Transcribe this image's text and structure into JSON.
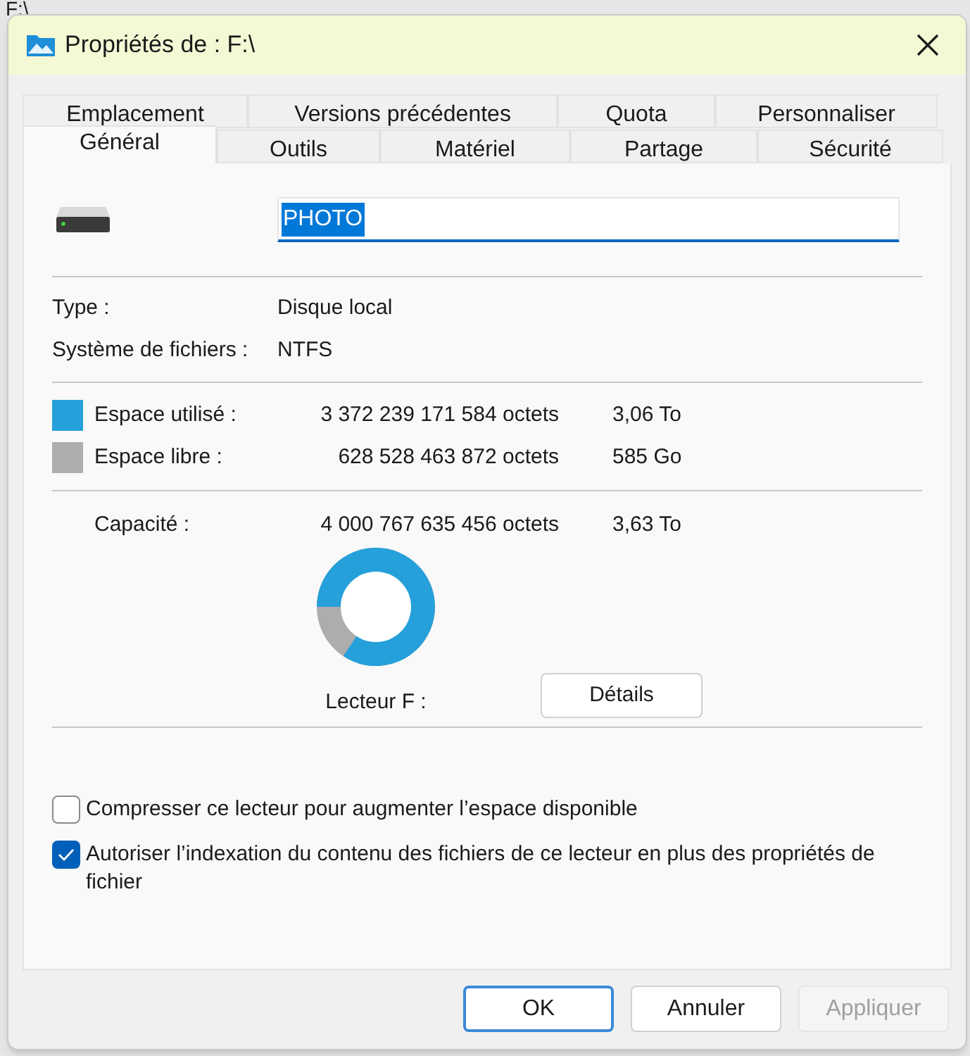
{
  "background": {
    "path": "F:\\"
  },
  "window": {
    "title": "Propriétés de : F:\\"
  },
  "tabs": {
    "row_1": [
      {
        "label": "Emplacement",
        "selected": false
      },
      {
        "label": "Versions précédentes",
        "selected": false
      },
      {
        "label": "Quota",
        "selected": false
      },
      {
        "label": "Personnaliser",
        "selected": false
      }
    ],
    "row_2": [
      {
        "label": "Général",
        "selected": true
      },
      {
        "label": "Outils",
        "selected": false
      },
      {
        "label": "Matériel",
        "selected": false
      },
      {
        "label": "Partage",
        "selected": false
      },
      {
        "label": "Sécurité",
        "selected": false
      }
    ]
  },
  "name_field": {
    "value": "PHOTO"
  },
  "info": [
    {
      "label": "Type :",
      "value": "Disque local"
    },
    {
      "label": "Système de fichiers :",
      "value": "NTFS"
    }
  ],
  "space": [
    {
      "label": "Espace utilisé :",
      "bytes": "3 372 239 171 584 octets",
      "size": "3,06 To",
      "color": "#26a0da"
    },
    {
      "label": "Espace libre :",
      "bytes": "628 528 463 872 octets",
      "size": "585 Go",
      "color": "#adadad"
    }
  ],
  "capacity": {
    "label": "Capacité :",
    "bytes": "4 000 767 635 456 octets",
    "size": "3,63 To"
  },
  "drive_label": "Lecteur F :",
  "details_button": "Détails",
  "options": [
    {
      "label": "Compresser ce lecteur pour augmenter l’espace disponible",
      "checked": false
    },
    {
      "label": "Autoriser l’indexation du contenu des fichiers de ce lecteur en plus des propriétés de fichier",
      "checked": true
    }
  ],
  "buttons": [
    {
      "label": "OK",
      "default": true,
      "disabled": false
    },
    {
      "label": "Annuler",
      "default": false,
      "disabled": false
    },
    {
      "label": "Appliquer",
      "default": false,
      "disabled": true
    }
  ]
}
